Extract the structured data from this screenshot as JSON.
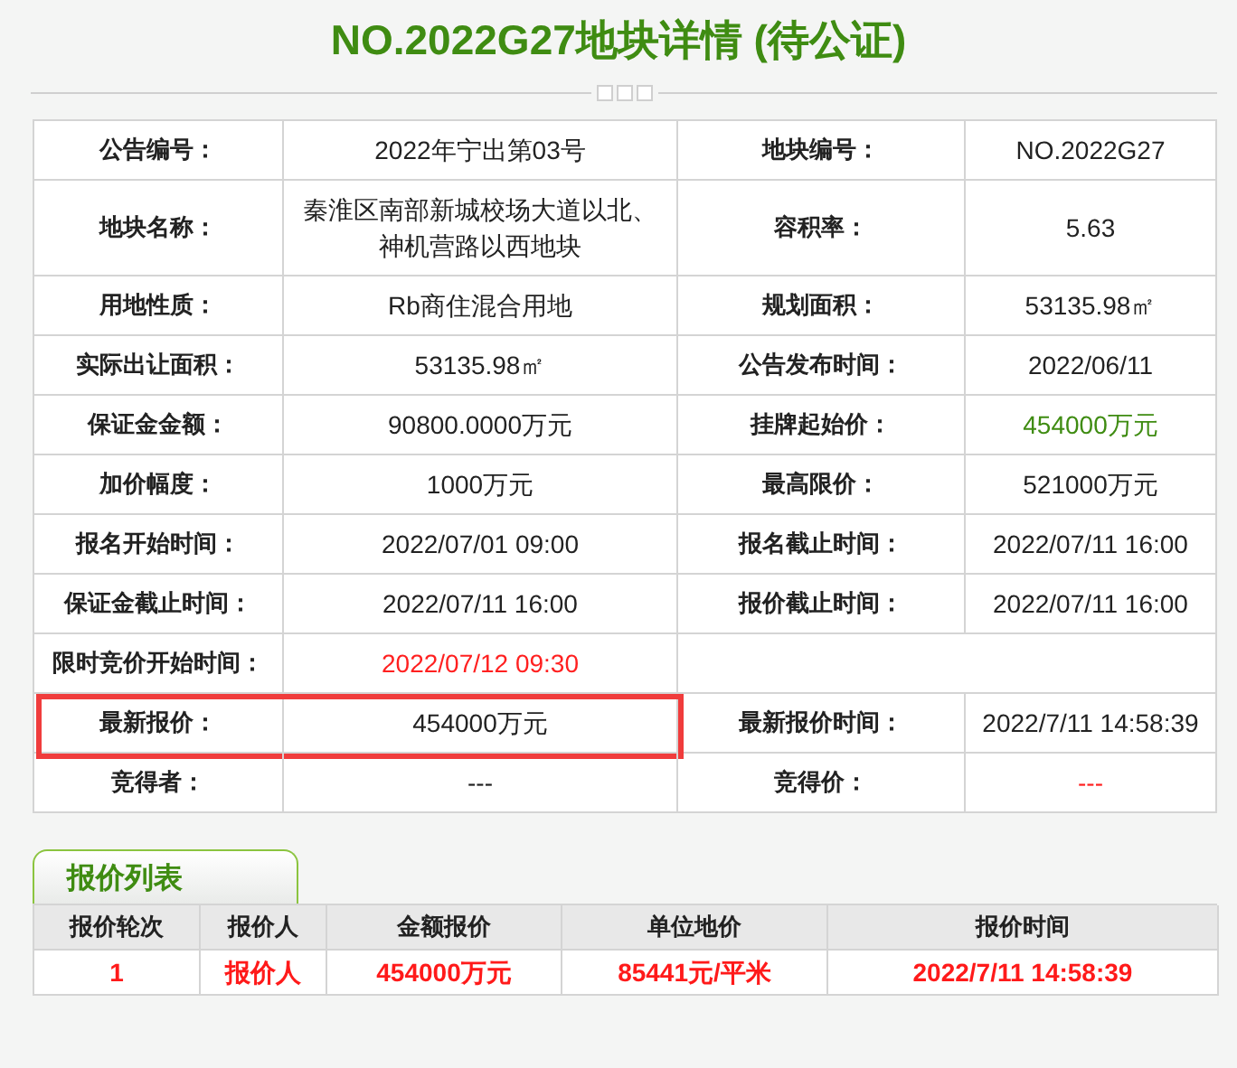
{
  "title": "NO.2022G27地块详情 (待公证)",
  "details": [
    {
      "highlighted": false,
      "pairs": [
        {
          "label": "公告编号：",
          "value": "2022年宁出第03号"
        },
        {
          "label": "地块编号：",
          "value": "NO.2022G27"
        }
      ]
    },
    {
      "highlighted": false,
      "pairs": [
        {
          "label": "地块名称：",
          "value": "秦淮区南部新城校场大道以北、神机营路以西地块"
        },
        {
          "label": "容积率：",
          "value": "5.63"
        }
      ]
    },
    {
      "highlighted": false,
      "pairs": [
        {
          "label": "用地性质：",
          "value": "Rb商住混合用地"
        },
        {
          "label": "规划面积：",
          "value": "53135.98㎡"
        }
      ]
    },
    {
      "highlighted": false,
      "pairs": [
        {
          "label": "实际出让面积：",
          "value": "53135.98㎡"
        },
        {
          "label": "公告发布时间：",
          "value": "2022/06/11"
        }
      ]
    },
    {
      "highlighted": false,
      "pairs": [
        {
          "label": "保证金金额：",
          "value": "90800.0000万元"
        },
        {
          "label": "挂牌起始价：",
          "value": "454000万元",
          "color": "#3f8c12"
        }
      ]
    },
    {
      "highlighted": false,
      "pairs": [
        {
          "label": "加价幅度：",
          "value": "1000万元"
        },
        {
          "label": "最高限价：",
          "value": "521000万元"
        }
      ]
    },
    {
      "highlighted": false,
      "pairs": [
        {
          "label": "报名开始时间：",
          "value": "2022/07/01 09:00"
        },
        {
          "label": "报名截止时间：",
          "value": "2022/07/11 16:00"
        }
      ]
    },
    {
      "highlighted": false,
      "pairs": [
        {
          "label": "保证金截止时间：",
          "value": "2022/07/11 16:00"
        },
        {
          "label": "报价截止时间：",
          "value": "2022/07/11 16:00"
        }
      ]
    },
    {
      "highlighted": false,
      "pairs": [
        {
          "label": "限时竞价开始时间：",
          "value": "2022/07/12 09:30",
          "color": "#ff2020"
        }
      ]
    },
    {
      "highlighted": true,
      "pairs": [
        {
          "label": "最新报价：",
          "value": "454000万元"
        },
        {
          "label": "最新报价时间：",
          "value": "2022/7/11 14:58:39"
        }
      ]
    },
    {
      "highlighted": false,
      "pairs": [
        {
          "label": "竞得者：",
          "value": "---"
        },
        {
          "label": "竞得价：",
          "value": "---",
          "color": "#ff2020"
        }
      ]
    }
  ],
  "bid_list": {
    "tab": "报价列表",
    "columns": [
      "报价轮次",
      "报价人",
      "金额报价",
      "单位地价",
      "报价时间"
    ],
    "rows": [
      [
        "1",
        "报价人",
        "454000万元",
        "85441元/平米",
        "2022/7/11 14:58:39"
      ]
    ]
  }
}
